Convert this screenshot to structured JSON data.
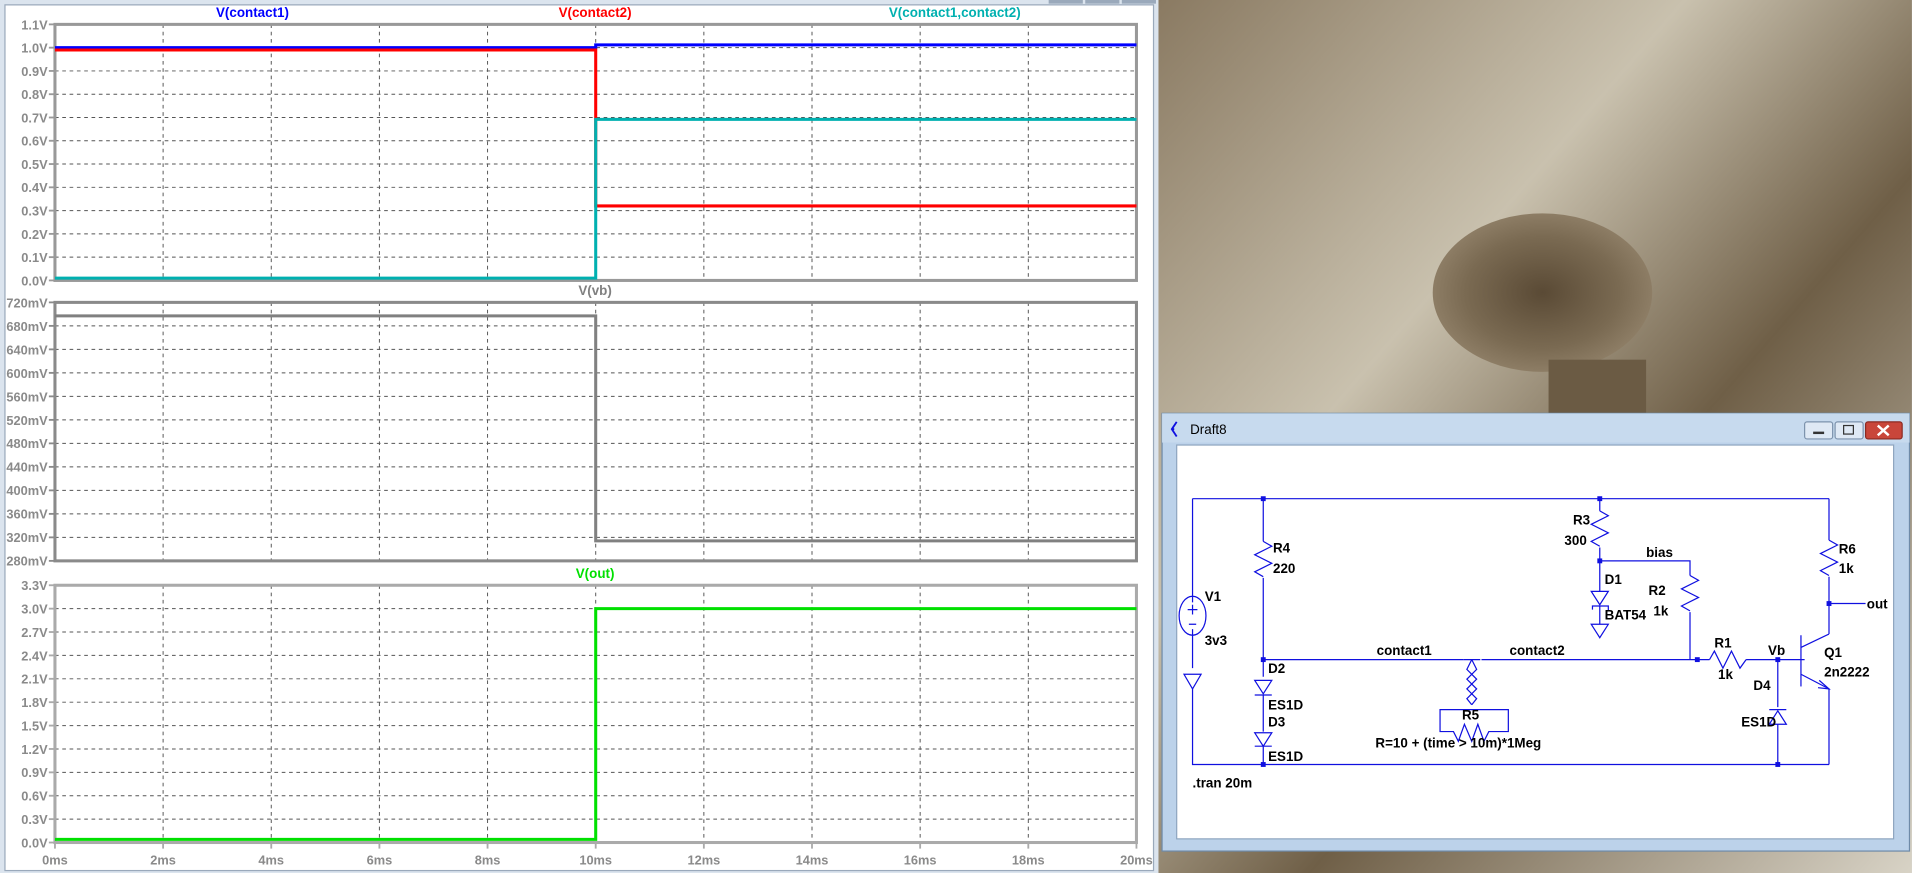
{
  "waveform_window": {
    "x_ticks": [
      "0ms",
      "2ms",
      "4ms",
      "6ms",
      "8ms",
      "10ms",
      "12ms",
      "14ms",
      "16ms",
      "18ms",
      "20ms"
    ]
  },
  "chart_data": [
    {
      "type": "line",
      "xlim": [
        0,
        20
      ],
      "xunit": "ms",
      "ylim": [
        0,
        1.1
      ],
      "y_ticks": [
        "0.0V",
        "0.1V",
        "0.2V",
        "0.3V",
        "0.4V",
        "0.5V",
        "0.6V",
        "0.7V",
        "0.8V",
        "0.9V",
        "1.0V",
        "1.1V"
      ],
      "grid": true,
      "series": [
        {
          "name": "V(contact1)",
          "color": "#0000ff",
          "x": [
            0,
            10,
            10,
            20
          ],
          "y": [
            1.0,
            1.0,
            1.012,
            1.012
          ]
        },
        {
          "name": "V(contact2)",
          "color": "#ff0000",
          "x": [
            0,
            10,
            10,
            20
          ],
          "y": [
            0.99,
            0.99,
            0.32,
            0.32
          ]
        },
        {
          "name": "V(contact1,contact2)",
          "color": "#00b0b0",
          "x": [
            0,
            10,
            10,
            20
          ],
          "y": [
            0.01,
            0.01,
            0.692,
            0.692
          ]
        }
      ]
    },
    {
      "type": "line",
      "xlim": [
        0,
        20
      ],
      "xunit": "ms",
      "ylim": [
        280,
        720
      ],
      "yunit": "mV",
      "y_ticks": [
        "280mV",
        "320mV",
        "360mV",
        "400mV",
        "440mV",
        "480mV",
        "520mV",
        "560mV",
        "600mV",
        "640mV",
        "680mV",
        "720mV"
      ],
      "grid": true,
      "series": [
        {
          "name": "V(vb)",
          "color": "#808080",
          "x": [
            0,
            10,
            10,
            20
          ],
          "y": [
            697,
            697,
            314,
            314
          ]
        }
      ]
    },
    {
      "type": "line",
      "xlim": [
        0,
        20
      ],
      "xunit": "ms",
      "ylim": [
        0,
        3.3
      ],
      "y_ticks": [
        "0.0V",
        "0.3V",
        "0.6V",
        "0.9V",
        "1.2V",
        "1.5V",
        "1.8V",
        "2.1V",
        "2.4V",
        "2.7V",
        "3.0V",
        "3.3V"
      ],
      "grid": true,
      "series": [
        {
          "name": "V(out)",
          "color": "#00e000",
          "x": [
            0,
            10,
            10,
            20
          ],
          "y": [
            0.04,
            0.04,
            3.0,
            3.0
          ]
        }
      ]
    }
  ],
  "schematic_window": {
    "title": "Draft8",
    "buttons": {
      "minimize": "minimize",
      "maximize": "maximize",
      "close": "close"
    },
    "labels": {
      "v1": "V1",
      "v1_val": "3v3",
      "r4": "R4",
      "r4_val": "220",
      "r3": "R3",
      "r3_val": "300",
      "r6": "R6",
      "r6_val": "1k",
      "r2": "R2",
      "r2_val": "1k",
      "r1": "R1",
      "r1_val": "1k",
      "d1": "D1",
      "d1_val": "BAT54",
      "d2": "D2",
      "d2_val": "ES1D",
      "d3": "D3",
      "d3_val": "ES1D",
      "d4": "D4",
      "d4_val": "ES1D",
      "q1": "Q1",
      "q1_val": "2n2222",
      "r5": "R5",
      "r5_val": "R=10 + (time > 10m)*1Meg",
      "net_bias": "bias",
      "net_out": "out",
      "net_vb": "Vb",
      "net_contact1": "contact1",
      "net_contact2": "contact2",
      "directive": ".tran 20m"
    }
  }
}
